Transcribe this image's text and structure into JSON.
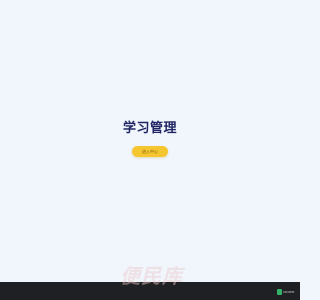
{
  "main": {
    "title": "学习管理",
    "enter_button_label": "进入中心"
  },
  "footer": {
    "watermark_text": "便民库",
    "logo_text": "SDWEN"
  },
  "colors": {
    "background": "#f1f6fd",
    "title": "#1f2462",
    "button": "#f5c62f",
    "footer": "#1f2023",
    "logo_green": "#34b26a"
  },
  "icons": {
    "footer_logo": "brand-logo-icon"
  }
}
